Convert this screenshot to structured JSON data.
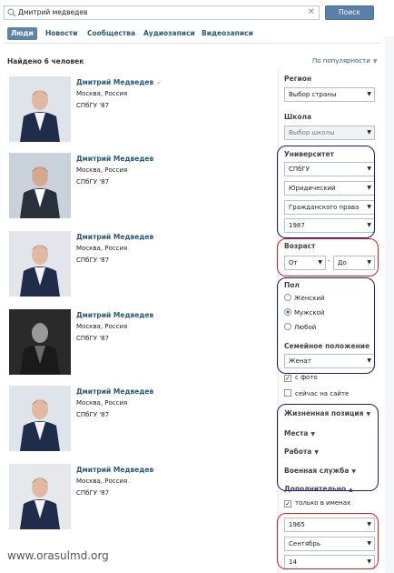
{
  "search": {
    "query": "Дмитрий медведев",
    "button": "Поиск"
  },
  "tabs": [
    "Люди",
    "Новости",
    "Сообщества",
    "Аудиозаписи",
    "Видеозаписи"
  ],
  "summary": {
    "found": "Найдено 6 человек",
    "sort": "По популярности"
  },
  "results": [
    {
      "name": "Дмитрий Медведев",
      "city": "Москва, Россия",
      "uni": "СПбГУ '87",
      "verified": true
    },
    {
      "name": "Дмитрий Медведев",
      "city": "Москва, Россия",
      "uni": "СПбГУ '87"
    },
    {
      "name": "Дмитрий Медведев",
      "city": "Москва, Россия",
      "uni": "СПбГУ '87"
    },
    {
      "name": "Дмитрий Медведев",
      "city": "Москва, Россия",
      "uni": "СПбГУ '87"
    },
    {
      "name": "Дмитрий Медведев",
      "city": "Москва, Россия",
      "uni": "СПбГУ '87"
    },
    {
      "name": "Дмитрий Медведев",
      "city": "Москва, Россия",
      "uni": "СПбГУ '87"
    }
  ],
  "filters": {
    "region_label": "Регион",
    "region_value": "Выбор страны",
    "school_label": "Школа",
    "school_value": "Выбор школы",
    "university_label": "Университет",
    "university_value": "СПбГУ",
    "faculty_value": "Юридический",
    "chair_value": "Гражданского права",
    "grad_year_value": "1987",
    "age_label": "Возраст",
    "age_from": "От",
    "age_dash": "-",
    "age_to": "До",
    "sex_label": "Пол",
    "sex_options": [
      "Женский",
      "Мужской",
      "Любой"
    ],
    "sex_selected": "Мужской",
    "marital_label": "Семейное положение",
    "marital_value": "Женат",
    "with_photo": "с фото",
    "online_now": "сейчас на сайте",
    "life_position": "Жизненная позиция",
    "places": "Места",
    "work": "Работа",
    "military": "Военная служба",
    "additional": "Дополнительно",
    "names_only": "только в именах",
    "birth_year": "1965",
    "birth_month": "Сентябрь",
    "birth_day": "14"
  },
  "watermark": "www.orasulmd.org",
  "colors": {
    "link": "#2b587a",
    "button": "#5b7fa6",
    "ring_blue": "#1a1a8c",
    "ring_red": "#d42020"
  }
}
